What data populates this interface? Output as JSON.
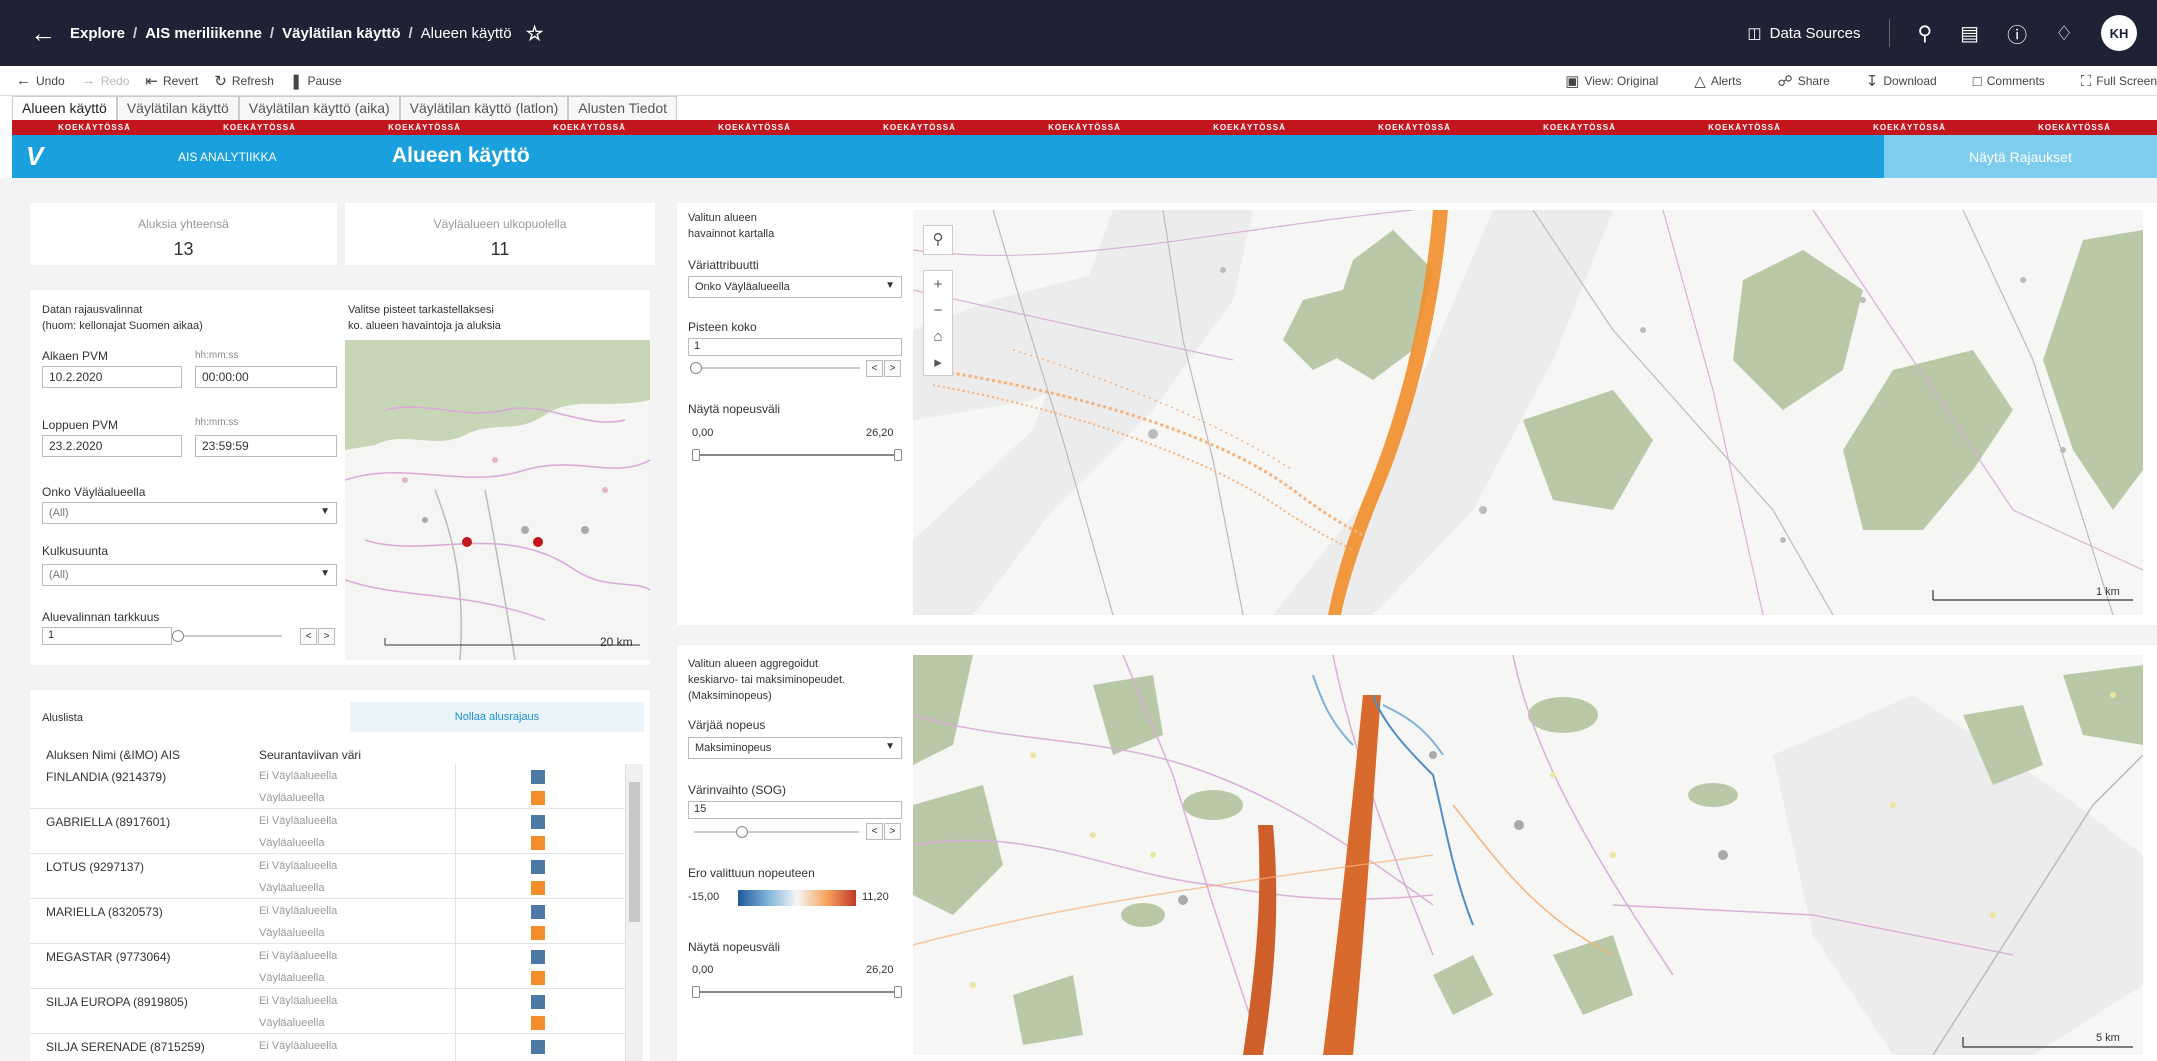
{
  "topbar": {
    "breadcrumbs": [
      "Explore",
      "AIS meriliikenne",
      "Väylätilan käyttö",
      "Alueen käyttö"
    ],
    "data_sources": "Data Sources",
    "avatar": "KH"
  },
  "toolbar": {
    "undo": "Undo",
    "redo": "Redo",
    "revert": "Revert",
    "refresh": "Refresh",
    "pause": "Pause",
    "view_original": "View: Original",
    "alerts": "Alerts",
    "share": "Share",
    "download": "Download",
    "comments": "Comments",
    "full_screen": "Full Screen"
  },
  "tabs": [
    "Alueen käyttö",
    "Väylätilan käyttö",
    "Väylätilan käyttö (aika)",
    "Väylätilan käyttö (latlon)",
    "Alusten Tiedot"
  ],
  "ribbon_text": "KOEKÄYTÖSSÄ",
  "ribbon_count": 13,
  "header": {
    "app_name": "AIS ANALYTIIKKA",
    "page_title": "Alueen käyttö",
    "show_filters_button": "Näytä Rajaukset"
  },
  "kpis": [
    {
      "label": "Aluksia yhteensä",
      "value": "13"
    },
    {
      "label": "Väyläalueen ulkopuolella",
      "value": "11"
    }
  ],
  "filters": {
    "title_line1": "Datan rajausvalinnat",
    "title_line2": "(huom: kellonajat Suomen aikaa)",
    "start_date_label": "Alkaen PVM",
    "start_time_label": "hh:mm:ss",
    "start_date": "10.2.2020",
    "start_time": "00:00:00",
    "end_date_label": "Loppuen PVM",
    "end_time_label": "hh:mm:ss",
    "end_date": "23.2.2020",
    "end_time": "23:59:59",
    "fairway_label": "Onko Väyläalueella",
    "fairway_value": "(All)",
    "direction_label": "Kulkusuunta",
    "direction_value": "(All)",
    "precision_label": "Aluevalinnan tarkkuus",
    "precision_value": "1"
  },
  "minimap": {
    "instruction_line1": "Valitse pisteet tarkastellaksesi",
    "instruction_line2": "ko. alueen havaintoja ja aluksia",
    "scale": "20 km"
  },
  "ship_list": {
    "title": "Aluslista",
    "reset_button": "Nollaa alusrajaus",
    "col_name": "Aluksen Nimi (&IMO) AIS",
    "col_color": "Seurantaviivan väri",
    "rows": [
      {
        "name": "FINLANDIA (9214379)",
        "l1": "Ei Väyläalueella",
        "l2": "Väyläalueella"
      },
      {
        "name": "GABRIELLA (8917601)",
        "l1": "Ei Väyläalueella",
        "l2": "Väyläalueella"
      },
      {
        "name": "LOTUS (9297137)",
        "l1": "Ei Väyläalueella",
        "l2": "Väyläalueella"
      },
      {
        "name": "MARIELLA (8320573)",
        "l1": "Ei Väyläalueella",
        "l2": "Väyläalueella"
      },
      {
        "name": "MEGASTAR (9773064)",
        "l1": "Ei Väyläalueella",
        "l2": "Väyläalueella"
      },
      {
        "name": "SILJA EUROPA (8919805)",
        "l1": "Ei Väyläalueella",
        "l2": "Väyläalueella"
      },
      {
        "name": "SILJA SERENADE (8715259)",
        "l1": "Ei Väyläalueella",
        "l2": ""
      }
    ]
  },
  "map1": {
    "title_line1": "Valitun alueen",
    "title_line2": "havainnot kartalla",
    "color_attr_label": "Väriattribuutti",
    "color_attr_value": "Onko Väyläalueella",
    "point_size_label": "Pisteen koko",
    "point_size_value": "1",
    "speed_range_label": "Näytä nopeusväli",
    "speed_min": "0,00",
    "speed_max": "26,20",
    "scale": "1 km"
  },
  "map2": {
    "title_line1": "Valitun alueen aggregoidut",
    "title_line2": "keskiarvo- tai maksiminopeudet.",
    "title_line3": "(Maksiminopeus)",
    "color_speed_label": "Värjää nopeus",
    "color_speed_value": "Maksiminopeus",
    "color_change_label": "Värinvaihto (SOG)",
    "color_change_value": "15",
    "diff_label": "Ero valittuun nopeuteen",
    "diff_min": "-15,00",
    "diff_max": "11,20",
    "speed_range_label": "Näytä nopeusväli",
    "speed_min": "0,00",
    "speed_max": "26,20",
    "scale": "5 km"
  },
  "colors": {
    "nav": "#1f2235",
    "header": "#1aa0dc",
    "ribbon": "#c3151e",
    "land": "#b9c9a8",
    "track": "#f28e2b",
    "blue": "#4e79a7"
  }
}
